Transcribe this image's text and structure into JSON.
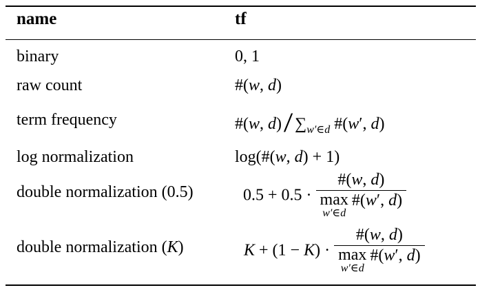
{
  "table": {
    "header": {
      "name": "name",
      "tf": "tf"
    },
    "rows": [
      {
        "name": "binary",
        "formula": "0, 1"
      },
      {
        "name": "raw count",
        "formula": "#(w, d)"
      },
      {
        "name": "term frequency",
        "formula": "#(w, d) / ∑_{w′∈d} #(w′, d)"
      },
      {
        "name": "log normalization",
        "formula": "log(#(w, d) + 1)"
      },
      {
        "name": "double normalization (0.5)",
        "formula": "0.5 + 0.5 · #(w, d) / max_{w′∈d} #(w′, d)"
      },
      {
        "name": "double normalization (K)",
        "formula": "K + (1 − K) · #(w, d) / max_{w′∈d} #(w′, d)"
      }
    ]
  }
}
